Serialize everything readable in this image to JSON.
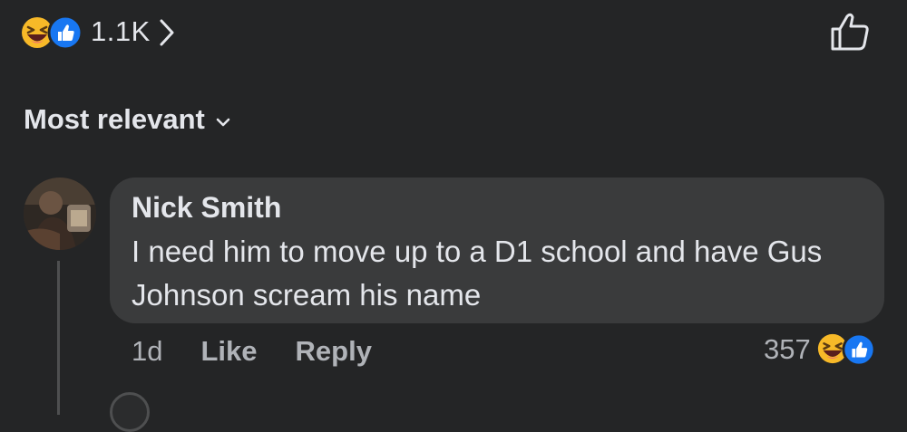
{
  "reactions": {
    "count": "1.1K",
    "icons": [
      "haha-emoji-icon",
      "like-reaction-icon"
    ]
  },
  "sort": {
    "label": "Most relevant"
  },
  "comment": {
    "author": "Nick Smith",
    "text": "I need him to move up to a D1 school and have Gus Johnson scream his name",
    "time": "1d",
    "like_label": "Like",
    "reply_label": "Reply",
    "reaction_count": "357",
    "reaction_icons": [
      "haha-emoji-icon",
      "like-reaction-icon"
    ]
  },
  "colors": {
    "background": "#242526",
    "bubble": "#3a3b3c",
    "primary_text": "#e4e6eb",
    "secondary_text": "#b0b3b8",
    "like_blue": "#1877f2",
    "haha_yellow": "#f7b928"
  }
}
